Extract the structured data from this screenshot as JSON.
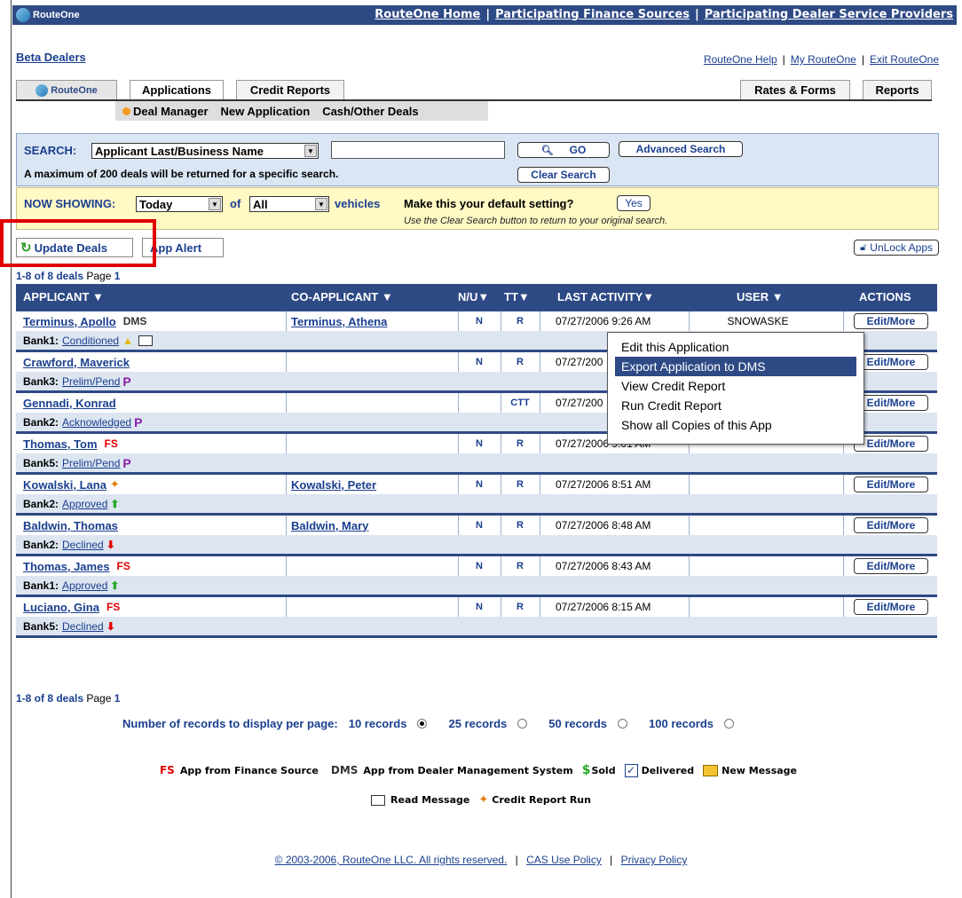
{
  "brand": "RouteOne",
  "top_nav": [
    "RouteOne Home",
    "Participating Finance Sources",
    "Participating Dealer Service Providers"
  ],
  "dealer": "Beta Dealers",
  "util_links": [
    "RouteOne Help",
    "My RouteOne",
    "Exit RouteOne"
  ],
  "tabs": {
    "left": [
      "Applications",
      "Credit Reports"
    ],
    "right": [
      "Rates & Forms",
      "Reports"
    ]
  },
  "subnav": [
    "Deal Manager",
    "New Application",
    "Cash/Other Deals"
  ],
  "search": {
    "label": "SEARCH:",
    "field": "Applicant Last/Business Name",
    "go": "GO",
    "advanced": "Advanced Search",
    "clear": "Clear Search",
    "note": "A maximum of 200 deals will be returned for a specific search."
  },
  "now_showing": {
    "label": "NOW SHOWING:",
    "period": "Today",
    "of": "of",
    "filter": "All",
    "vehicles": "vehicles",
    "default_q": "Make this your default setting?",
    "yes": "Yes",
    "note": "Use the Clear Search button to return to your original search."
  },
  "update_deals": "Update Deals",
  "app_alert": "App Alert",
  "unlock_apps": "UnLock Apps",
  "count_text": "1-8 of 8 deals",
  "page_label": "Page",
  "page_num": "1",
  "columns": [
    "APPLICANT",
    "CO-APPLICANT",
    "N/U",
    "TT",
    "LAST ACTIVITY",
    "USER",
    "ACTIONS"
  ],
  "edit_more": "Edit/More",
  "rows": [
    {
      "applicant": "Terminus, Apollo",
      "tag": "DMS",
      "co": "Terminus, Athena",
      "nu": "N",
      "tt": "R",
      "date": "07/27/2006 9:26 AM",
      "user": "SNOWASKE",
      "bank": "Bank1:",
      "status": "Conditioned"
    },
    {
      "applicant": "Crawford, Maverick",
      "tag": "",
      "co": "",
      "nu": "N",
      "tt": "R",
      "date": "07/27/200",
      "user": "",
      "bank": "Bank3:",
      "status": "Prelim/Pend"
    },
    {
      "applicant": "Gennadi, Konrad",
      "tag": "",
      "co": "",
      "nu": "",
      "tt": "CTT",
      "date": "07/27/200",
      "user": "",
      "bank": "Bank2:",
      "status": "Acknowledged"
    },
    {
      "applicant": "Thomas, Tom",
      "tag": "FS",
      "co": "",
      "nu": "N",
      "tt": "R",
      "date": "07/27/2006 9:01 AM",
      "user": "",
      "bank": "Bank5:",
      "status": "Prelim/Pend"
    },
    {
      "applicant": "Kowalski, Lana",
      "tag": "",
      "co": "Kowalski, Peter",
      "nu": "N",
      "tt": "R",
      "date": "07/27/2006 8:51 AM",
      "user": "",
      "bank": "Bank2:",
      "status": "Approved"
    },
    {
      "applicant": "Baldwin, Thomas",
      "tag": "",
      "co": "Baldwin, Mary",
      "nu": "N",
      "tt": "R",
      "date": "07/27/2006 8:48 AM",
      "user": "",
      "bank": "Bank2:",
      "status": "Declined"
    },
    {
      "applicant": "Thomas, James",
      "tag": "FS",
      "co": "",
      "nu": "N",
      "tt": "R",
      "date": "07/27/2006 8:43 AM",
      "user": "",
      "bank": "Bank1:",
      "status": "Approved"
    },
    {
      "applicant": "Luciano, Gina",
      "tag": "FS",
      "co": "",
      "nu": "N",
      "tt": "R",
      "date": "07/27/2006 8:15 AM",
      "user": "",
      "bank": "Bank5:",
      "status": "Declined"
    }
  ],
  "context_menu": [
    "Edit this Application",
    "Export Application to DMS",
    "View Credit Report",
    "Run Credit Report",
    "Show all Copies of this App"
  ],
  "per_page": {
    "label": "Number of records to display per page:",
    "options": [
      "10 records",
      "25 records",
      "50 records",
      "100 records"
    ]
  },
  "legend": {
    "fs_tag": "FS",
    "fs": "App from Finance Source",
    "dms_tag": "DMS",
    "dms": "App from Dealer Management System",
    "sold": "Sold",
    "delivered": "Delivered",
    "new_message": "New Message",
    "read_message": "Read Message",
    "credit_report_run": "Credit Report Run"
  },
  "footer": {
    "copyright": "© 2003-2006, RouteOne LLC. All rights reserved.",
    "cas": "CAS Use Policy",
    "privacy": "Privacy Policy"
  },
  "colors": {
    "navy": "#2e4a85",
    "red": "#e00000",
    "panel_blue": "#dbe6f4",
    "panel_yellow": "#fff9c4"
  }
}
